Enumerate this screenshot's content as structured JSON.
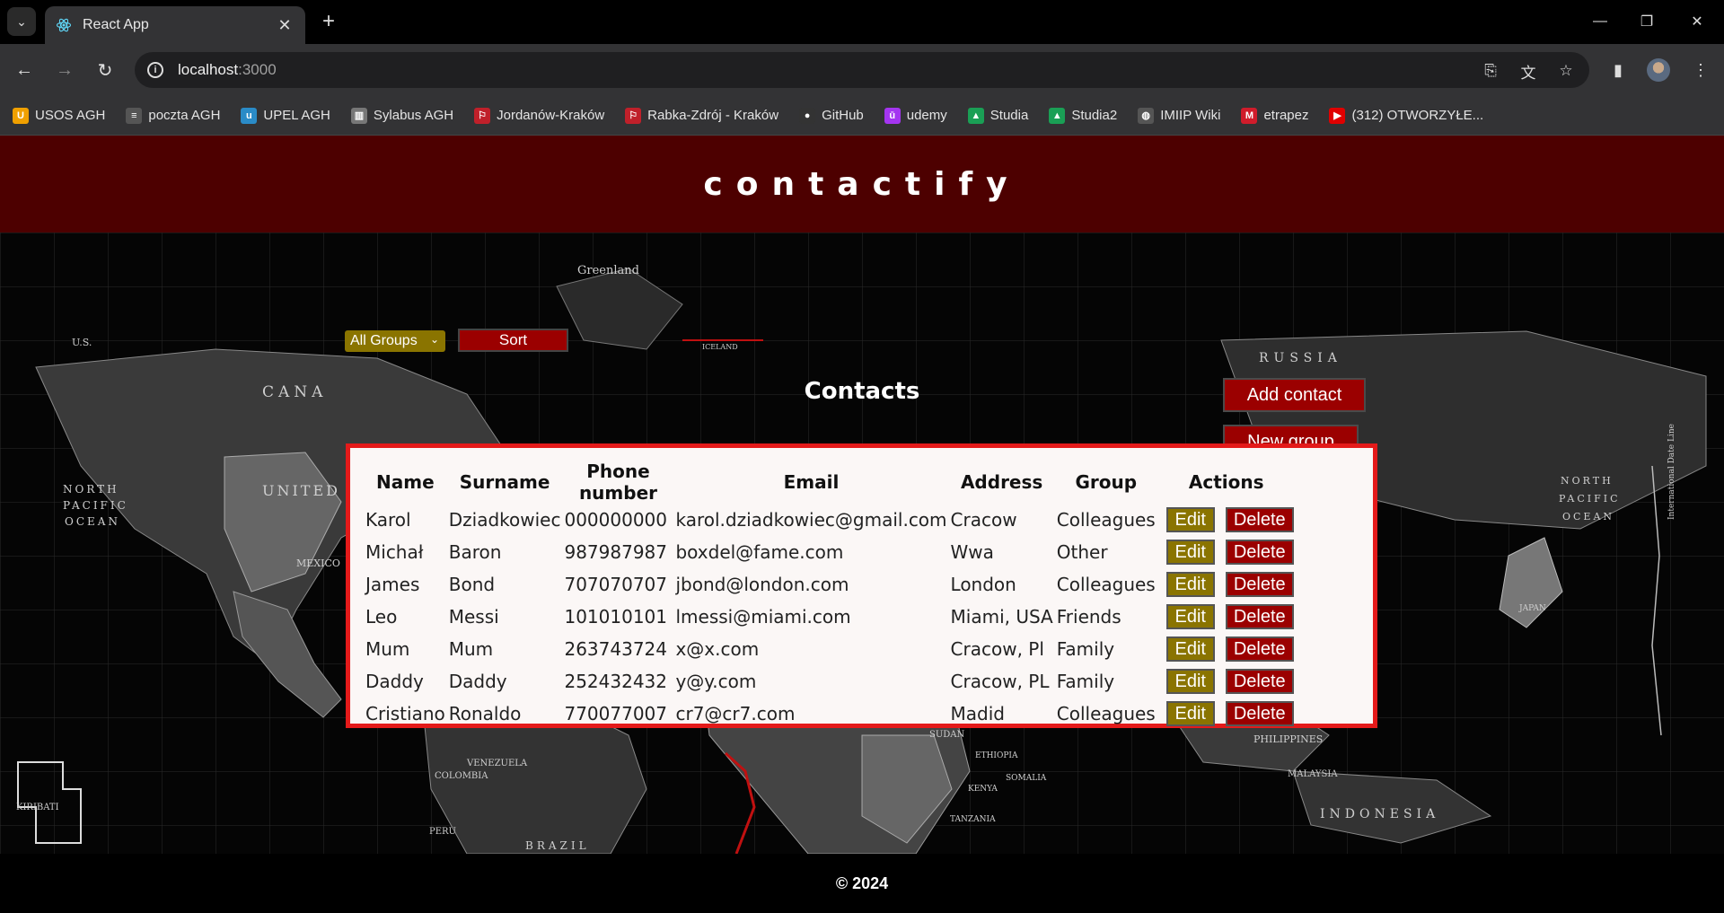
{
  "browser": {
    "tab_title": "React App",
    "url_host": "localhost",
    "url_port": ":3000",
    "bookmarks": [
      {
        "label": "USOS AGH",
        "icon": "usos-icon",
        "color": "#f0a000",
        "glyph": "U"
      },
      {
        "label": "poczta AGH",
        "icon": "mail-icon",
        "color": "#555555",
        "glyph": "≡"
      },
      {
        "label": "UPEL AGH",
        "icon": "upel-icon",
        "color": "#2a8bc7",
        "glyph": "u"
      },
      {
        "label": "Sylabus AGH",
        "icon": "books-icon",
        "color": "#777777",
        "glyph": "▥"
      },
      {
        "label": "Jordanów-Kraków",
        "icon": "bus-icon",
        "color": "#c0202a",
        "glyph": "⚐"
      },
      {
        "label": "Rabka-Zdrój - Kraków",
        "icon": "bus-icon",
        "color": "#c0202a",
        "glyph": "⚐"
      },
      {
        "label": "GitHub",
        "icon": "github-icon",
        "color": "#333333",
        "glyph": "●"
      },
      {
        "label": "udemy",
        "icon": "udemy-icon",
        "color": "#a435f0",
        "glyph": "ū"
      },
      {
        "label": "Studia",
        "icon": "drive-icon",
        "color": "#1a9f55",
        "glyph": "▲"
      },
      {
        "label": "Studia2",
        "icon": "drive-icon",
        "color": "#1a9f55",
        "glyph": "▲"
      },
      {
        "label": "IMIIP Wiki",
        "icon": "globe-icon",
        "color": "#555555",
        "glyph": "◍"
      },
      {
        "label": "etrapez",
        "icon": "etrapez-icon",
        "color": "#d01c2b",
        "glyph": "M"
      },
      {
        "label": "(312) OTWORZYŁE...",
        "icon": "youtube-icon",
        "color": "#e00000",
        "glyph": "▶"
      }
    ]
  },
  "app": {
    "brand": "contactify",
    "add_contact_label": "Add contact",
    "new_group_label": "New group",
    "group_filter_value": "All Groups",
    "sort_label": "Sort",
    "contacts_title": "Contacts",
    "footer": "© 2024"
  },
  "table": {
    "headers": [
      "Name",
      "Surname",
      "Phone number",
      "Email",
      "Address",
      "Group",
      "Actions"
    ],
    "edit_label": "Edit",
    "delete_label": "Delete",
    "rows": [
      [
        "Karol",
        "Dziadkowiec",
        "000000000",
        "karol.dziadkowiec@gmail.com",
        "Cracow",
        "Colleagues"
      ],
      [
        "Michał",
        "Baron",
        "987987987",
        "boxdel@fame.com",
        "Wwa",
        "Other"
      ],
      [
        "James",
        "Bond",
        "707070707",
        "jbond@london.com",
        "London",
        "Colleagues"
      ],
      [
        "Leo",
        "Messi",
        "101010101",
        "lmessi@miami.com",
        "Miami, USA",
        "Friends"
      ],
      [
        "Mum",
        "Mum",
        "263743724",
        "x@x.com",
        "Cracow, Pl",
        "Family"
      ],
      [
        "Daddy",
        "Daddy",
        "252432432",
        "y@y.com",
        "Cracow, PL",
        "Family"
      ],
      [
        "Cristiano",
        "Ronaldo",
        "770077007",
        "cr7@cr7.com",
        "Madid",
        "Colleagues"
      ]
    ]
  },
  "map_labels": [
    "CANA",
    "UNITED",
    "NORTH",
    "PACIFIC",
    "OCEAN",
    "MEXICO",
    "KIRIBATI",
    "VENEZUELA",
    "COLOMBIA",
    "PERU",
    "BRAZIL",
    "SUDAN",
    "ETHIOPIA",
    "SOMALIA",
    "KENYA",
    "TANZANIA",
    "PHILIPPINES",
    "MALAYSIA",
    "INDONESIA",
    "JAPAN",
    "RUSSIA",
    "Greenland",
    "ICELAND",
    "U.S.",
    "NORTH",
    "PACIFIC",
    "OCEAN",
    "International Date Line"
  ],
  "colors": {
    "header_bg": "#4d0000",
    "accent_red": "#9b0000",
    "accent_olive": "#8a7400",
    "table_border": "#e41a1a"
  }
}
